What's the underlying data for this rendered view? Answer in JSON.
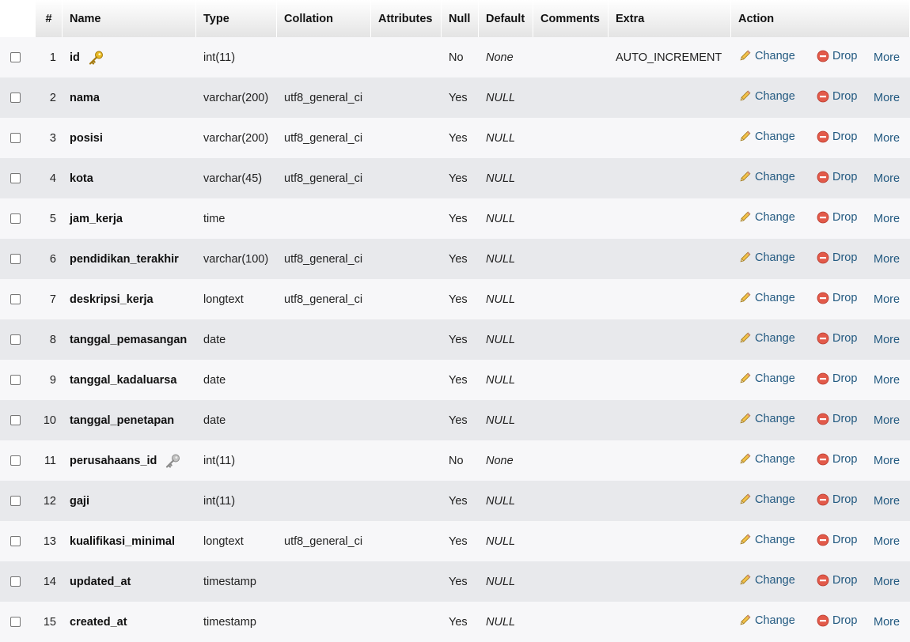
{
  "headers": {
    "num": "#",
    "name": "Name",
    "type": "Type",
    "collation": "Collation",
    "attributes": "Attributes",
    "null": "Null",
    "default": "Default",
    "comments": "Comments",
    "extra": "Extra",
    "action": "Action"
  },
  "actions": {
    "change": "Change",
    "drop": "Drop",
    "more": "More"
  },
  "colors": {
    "link": "#235a81",
    "primary_key": "#e8b923",
    "index_key": "#a0a0a0",
    "drop": "#e25a4a"
  },
  "rows": [
    {
      "num": "1",
      "name": "id",
      "key": "primary",
      "type": "int(11)",
      "collation": "",
      "attributes": "",
      "null": "No",
      "default": "None",
      "comments": "",
      "extra": "AUTO_INCREMENT"
    },
    {
      "num": "2",
      "name": "nama",
      "key": "",
      "type": "varchar(200)",
      "collation": "utf8_general_ci",
      "attributes": "",
      "null": "Yes",
      "default": "NULL",
      "comments": "",
      "extra": ""
    },
    {
      "num": "3",
      "name": "posisi",
      "key": "",
      "type": "varchar(200)",
      "collation": "utf8_general_ci",
      "attributes": "",
      "null": "Yes",
      "default": "NULL",
      "comments": "",
      "extra": ""
    },
    {
      "num": "4",
      "name": "kota",
      "key": "",
      "type": "varchar(45)",
      "collation": "utf8_general_ci",
      "attributes": "",
      "null": "Yes",
      "default": "NULL",
      "comments": "",
      "extra": ""
    },
    {
      "num": "5",
      "name": "jam_kerja",
      "key": "",
      "type": "time",
      "collation": "",
      "attributes": "",
      "null": "Yes",
      "default": "NULL",
      "comments": "",
      "extra": ""
    },
    {
      "num": "6",
      "name": "pendidikan_terakhir",
      "key": "",
      "type": "varchar(100)",
      "collation": "utf8_general_ci",
      "attributes": "",
      "null": "Yes",
      "default": "NULL",
      "comments": "",
      "extra": ""
    },
    {
      "num": "7",
      "name": "deskripsi_kerja",
      "key": "",
      "type": "longtext",
      "collation": "utf8_general_ci",
      "attributes": "",
      "null": "Yes",
      "default": "NULL",
      "comments": "",
      "extra": ""
    },
    {
      "num": "8",
      "name": "tanggal_pemasangan",
      "key": "",
      "type": "date",
      "collation": "",
      "attributes": "",
      "null": "Yes",
      "default": "NULL",
      "comments": "",
      "extra": ""
    },
    {
      "num": "9",
      "name": "tanggal_kadaluarsa",
      "key": "",
      "type": "date",
      "collation": "",
      "attributes": "",
      "null": "Yes",
      "default": "NULL",
      "comments": "",
      "extra": ""
    },
    {
      "num": "10",
      "name": "tanggal_penetapan",
      "key": "",
      "type": "date",
      "collation": "",
      "attributes": "",
      "null": "Yes",
      "default": "NULL",
      "comments": "",
      "extra": ""
    },
    {
      "num": "11",
      "name": "perusahaans_id",
      "key": "index",
      "type": "int(11)",
      "collation": "",
      "attributes": "",
      "null": "No",
      "default": "None",
      "comments": "",
      "extra": ""
    },
    {
      "num": "12",
      "name": "gaji",
      "key": "",
      "type": "int(11)",
      "collation": "",
      "attributes": "",
      "null": "Yes",
      "default": "NULL",
      "comments": "",
      "extra": ""
    },
    {
      "num": "13",
      "name": "kualifikasi_minimal",
      "key": "",
      "type": "longtext",
      "collation": "utf8_general_ci",
      "attributes": "",
      "null": "Yes",
      "default": "NULL",
      "comments": "",
      "extra": ""
    },
    {
      "num": "14",
      "name": "updated_at",
      "key": "",
      "type": "timestamp",
      "collation": "",
      "attributes": "",
      "null": "Yes",
      "default": "NULL",
      "comments": "",
      "extra": ""
    },
    {
      "num": "15",
      "name": "created_at",
      "key": "",
      "type": "timestamp",
      "collation": "",
      "attributes": "",
      "null": "Yes",
      "default": "NULL",
      "comments": "",
      "extra": ""
    }
  ]
}
